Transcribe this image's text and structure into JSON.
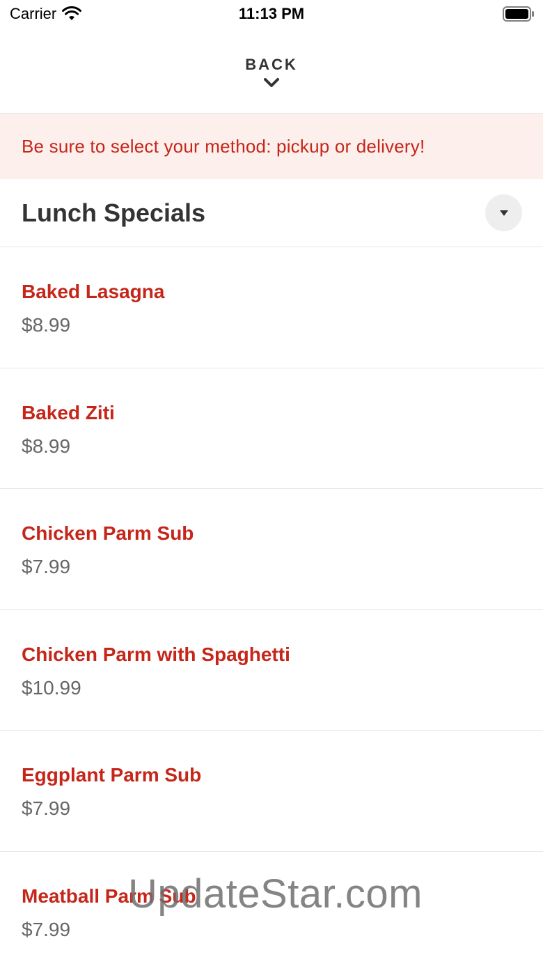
{
  "status_bar": {
    "carrier": "Carrier",
    "time": "11:13 PM"
  },
  "header": {
    "back_label": "BACK"
  },
  "banner": {
    "text": "Be sure to select your method: pickup or delivery!"
  },
  "section": {
    "title": "Lunch Specials"
  },
  "menu_items": [
    {
      "name": "Baked Lasagna",
      "price": "$8.99"
    },
    {
      "name": "Baked Ziti",
      "price": "$8.99"
    },
    {
      "name": "Chicken Parm Sub",
      "price": "$7.99"
    },
    {
      "name": "Chicken Parm with Spaghetti",
      "price": "$10.99"
    },
    {
      "name": "Eggplant Parm Sub",
      "price": "$7.99"
    },
    {
      "name": "Meatball Parm Sub",
      "price": "$7.99"
    }
  ],
  "watermark": "UpdateStar.com",
  "colors": {
    "accent_red": "#c6261a",
    "banner_bg": "#fdefec",
    "price_gray": "#666666"
  },
  "icons": {
    "wifi": "wifi-icon",
    "battery": "battery-icon",
    "back_chevron": "chevron-down-icon",
    "collapse": "triangle-down-icon"
  }
}
